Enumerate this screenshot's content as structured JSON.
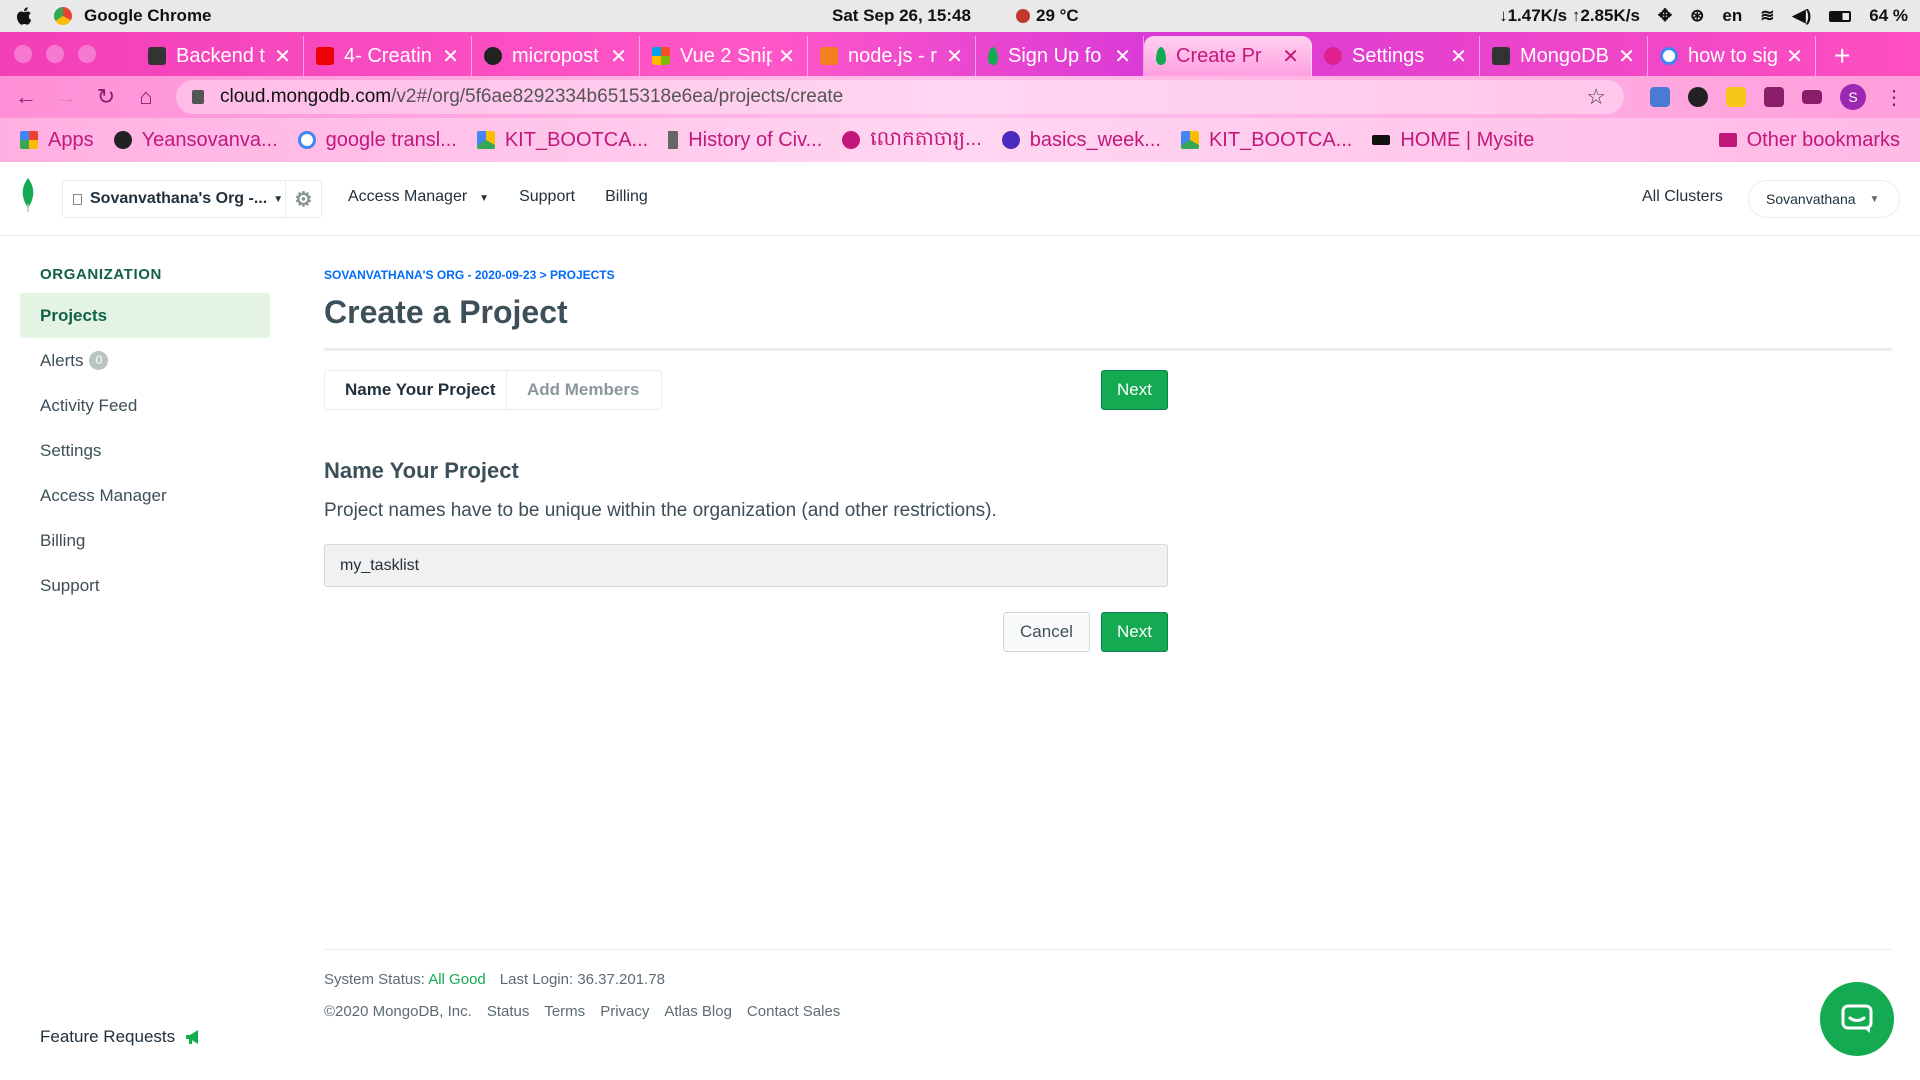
{
  "menubar": {
    "app_name": "Google Chrome",
    "clock": "Sat Sep 26, 15:48",
    "weather": "29 °C",
    "network": "↓1.47K/s ↑2.85K/s",
    "language": "en",
    "battery": "64 %"
  },
  "tabs": [
    {
      "title": "Backend t",
      "icon": "avatar-icon"
    },
    {
      "title": "4- Creatin",
      "icon": "youtube-icon"
    },
    {
      "title": "micropost",
      "icon": "github-icon"
    },
    {
      "title": "Vue 2 Snip",
      "icon": "windows-store-icon"
    },
    {
      "title": "node.js - r",
      "icon": "stackoverflow-icon"
    },
    {
      "title": "Sign Up fo",
      "icon": "mongodb-leaf-icon"
    },
    {
      "title": "Create Pr",
      "icon": "mongodb-leaf-icon",
      "active": true
    },
    {
      "title": "Settings",
      "icon": "gear-icon"
    },
    {
      "title": "MongoDB",
      "icon": "avatar-icon"
    },
    {
      "title": "how to sig",
      "icon": "google-icon"
    }
  ],
  "address_bar": {
    "host": "cloud.mongodb.com",
    "path": "/v2#/org/5f6ae8292334b6515318e6ea/projects/create",
    "profile_initial": "S"
  },
  "bookmarks": [
    {
      "label": "Apps",
      "icon": "apps-grid-icon"
    },
    {
      "label": "Yeansovanva...",
      "icon": "github-icon"
    },
    {
      "label": "google transl...",
      "icon": "google-icon"
    },
    {
      "label": "KIT_BOOTCA...",
      "icon": "google-drive-icon"
    },
    {
      "label": "History of Civ...",
      "icon": "page-icon"
    },
    {
      "label": "លោកតាចារ្យ...",
      "icon": "site-icon"
    },
    {
      "label": "basics_week...",
      "icon": "k-icon"
    },
    {
      "label": "KIT_BOOTCA...",
      "icon": "google-drive-icon"
    },
    {
      "label": "HOME | Mysite",
      "icon": "wix-icon"
    }
  ],
  "bookmarks_overflow": "»",
  "other_bookmarks": "Other bookmarks",
  "atlas": {
    "org_name": "Sovanvathana's Org -...",
    "nav": {
      "access_manager": "Access Manager",
      "support": "Support",
      "billing": "Billing"
    },
    "all_clusters": "All Clusters",
    "user": "Sovanvathana"
  },
  "sidebar": {
    "heading": "ORGANIZATION",
    "items": [
      {
        "label": "Projects",
        "active": true
      },
      {
        "label": "Alerts",
        "badge": "0"
      },
      {
        "label": "Activity Feed"
      },
      {
        "label": "Settings"
      },
      {
        "label": "Access Manager"
      },
      {
        "label": "Billing"
      },
      {
        "label": "Support"
      }
    ],
    "feature_requests": "Feature Requests"
  },
  "main": {
    "breadcrumb_org": "SOVANVATHANA'S ORG - 2020-09-23",
    "breadcrumb_sep": ">",
    "breadcrumb_page": "PROJECTS",
    "title": "Create a Project",
    "steps": [
      "Name Your Project",
      "Add Members"
    ],
    "next_label": "Next",
    "section_title": "Name Your Project",
    "help_text": "Project names have to be unique within the organization (and other restrictions).",
    "project_name_value": "my_tasklist",
    "cancel_label": "Cancel"
  },
  "footer": {
    "status_label": "System Status:",
    "status_value": "All Good",
    "last_login": "Last Login: 36.37.201.78",
    "copyright": "©2020 MongoDB, Inc.",
    "links": [
      "Status",
      "Terms",
      "Privacy",
      "Atlas Blog",
      "Contact Sales"
    ]
  },
  "colors": {
    "brand_green": "#13aa52",
    "active_bg": "#e4f4e4",
    "breadcrumb_blue": "#016bf8",
    "tabstrip_pink": "#f23fb8"
  }
}
